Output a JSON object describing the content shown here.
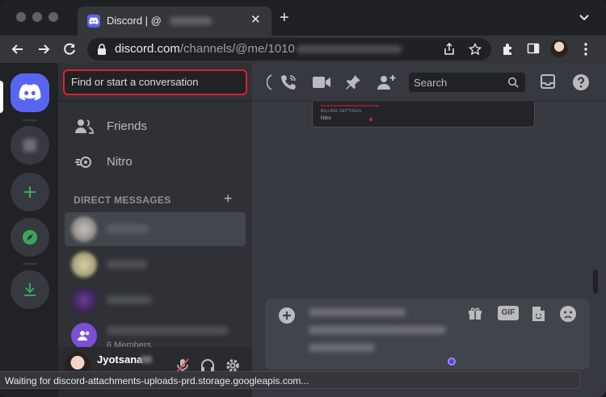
{
  "browser": {
    "tab_title": "Discord | @",
    "tab_close": "✕",
    "new_tab": "+",
    "url_host": "discord.com",
    "url_path": "/channels/@me/1010",
    "status_text": "Waiting for discord-attachments-uploads-prd.storage.googleapis.com..."
  },
  "sidebar": {
    "search_placeholder": "Find or start a conversation",
    "nav": [
      {
        "label": "Friends",
        "icon": "friends-icon"
      },
      {
        "label": "Nitro",
        "icon": "nitro-icon"
      }
    ],
    "dm_header": "DIRECT MESSAGES",
    "dm_add": "+",
    "group_members": "6 Members",
    "user_name": "Jyotsana"
  },
  "chat": {
    "search_placeholder": "Search",
    "embed_title": "BILLING SETTINGS",
    "embed_item": "Nitro",
    "gif_label": "GIF"
  },
  "colors": {
    "blurple": "#5865f2",
    "green": "#3ba55d",
    "highlight": "#e0202a"
  }
}
